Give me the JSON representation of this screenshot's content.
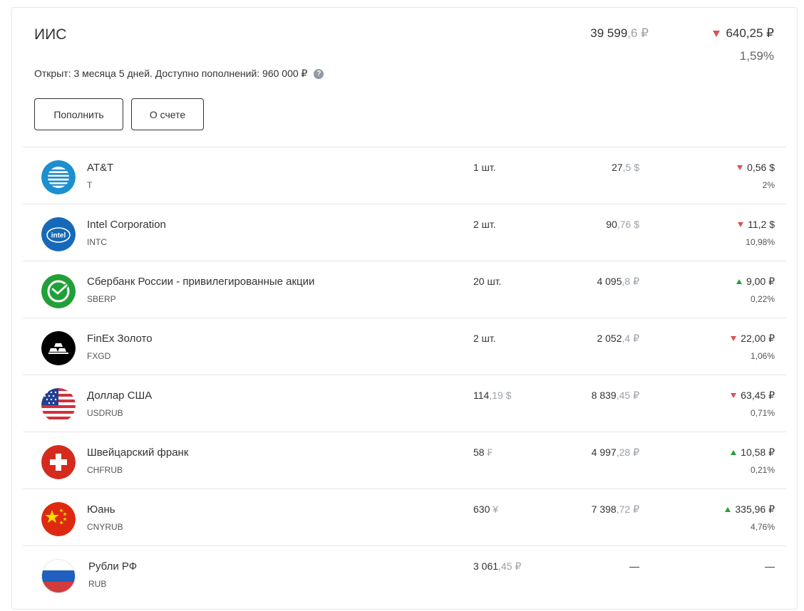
{
  "account": {
    "title": "ИИС",
    "total_main": "39 599",
    "total_frac": ",6 ₽",
    "change": "640,25 ₽",
    "change_direction": "down",
    "percent": "1,59%",
    "info": "Открыт: 3 месяца 5 дней. Доступно пополнений: 960 000 ₽",
    "help_icon": "?",
    "buttons": {
      "topup": "Пополнить",
      "about": "О счете"
    }
  },
  "colors": {
    "down": "#d9534f",
    "up": "#21a038",
    "muted": "#9ba0a7"
  },
  "positions": [
    {
      "logo": "att-icon",
      "name": "AT&T",
      "ticker": "T",
      "qty_main": "1 шт.",
      "qty_frac": "",
      "price_main": "27",
      "price_frac": ",5 $",
      "change": "0,56 $",
      "dir": "down",
      "pct": "2%"
    },
    {
      "logo": "intel-icon",
      "name": "Intel Corporation",
      "ticker": "INTC",
      "qty_main": "2 шт.",
      "qty_frac": "",
      "price_main": "90",
      "price_frac": ",76 $",
      "change": "11,2 $",
      "dir": "down",
      "pct": "10,98%"
    },
    {
      "logo": "sberbank-icon",
      "name": "Сбербанк России - привилегированные акции",
      "ticker": "SBERP",
      "qty_main": "20 шт.",
      "qty_frac": "",
      "price_main": "4 095",
      "price_frac": ",8 ₽",
      "change": "9,00 ₽",
      "dir": "up",
      "pct": "0,22%"
    },
    {
      "logo": "gold-bars-icon",
      "name": "FinEx Золото",
      "ticker": "FXGD",
      "qty_main": "2 шт.",
      "qty_frac": "",
      "price_main": "2 052",
      "price_frac": ",4 ₽",
      "change": "22,00 ₽",
      "dir": "down",
      "pct": "1,06%"
    },
    {
      "logo": "us-flag-icon",
      "name": "Доллар США",
      "ticker": "USDRUB",
      "qty_main": "114",
      "qty_frac": ",19 $",
      "price_main": "8 839",
      "price_frac": ",45 ₽",
      "change": "63,45 ₽",
      "dir": "down",
      "pct": "0,71%"
    },
    {
      "logo": "swiss-flag-icon",
      "name": "Швейцарский франк",
      "ticker": "CHFRUB",
      "qty_main": "58",
      "qty_frac": " ₣",
      "price_main": "4 997",
      "price_frac": ",28 ₽",
      "change": "10,58 ₽",
      "dir": "up",
      "pct": "0,21%"
    },
    {
      "logo": "china-flag-icon",
      "name": "Юань",
      "ticker": "CNYRUB",
      "qty_main": "630",
      "qty_frac": " ¥",
      "price_main": "7 398",
      "price_frac": ",72 ₽",
      "change": "335,96 ₽",
      "dir": "up",
      "pct": "4,76%"
    },
    {
      "logo": "russia-flag-icon",
      "name": "Рубли РФ",
      "ticker": "RUB",
      "qty_main": "3 061",
      "qty_frac": ",45 ₽",
      "price_main": "—",
      "price_frac": "",
      "change": "—",
      "dir": "none",
      "pct": ""
    }
  ]
}
